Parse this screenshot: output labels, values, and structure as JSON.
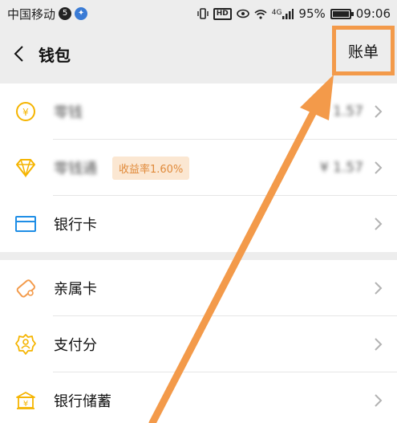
{
  "status_bar": {
    "carrier": "中国移动",
    "network": "4G",
    "battery": "95%",
    "battery_level": 0.95,
    "time": "09:06",
    "hd": "HD"
  },
  "nav": {
    "title": "钱包",
    "bill_label": "账单"
  },
  "section1": {
    "items": [
      {
        "label": "零钱",
        "value": "¥ 1.57",
        "icon": "yen-coin-icon"
      },
      {
        "label": "零钱通",
        "badge": "收益率1.60%",
        "value": "¥ 1.57",
        "icon": "diamond-icon"
      },
      {
        "label": "银行卡",
        "icon": "bank-card-icon"
      }
    ]
  },
  "section2": {
    "items": [
      {
        "label": "亲属卡",
        "icon": "family-card-icon"
      },
      {
        "label": "支付分",
        "icon": "pay-score-icon"
      },
      {
        "label": "银行储蓄",
        "icon": "bank-savings-icon"
      }
    ]
  },
  "colors": {
    "accent_yellow": "#f5b400",
    "accent_blue": "#1f8ee6",
    "highlight_orange": "#f39a4a",
    "badge_bg": "#fbe7d2"
  }
}
